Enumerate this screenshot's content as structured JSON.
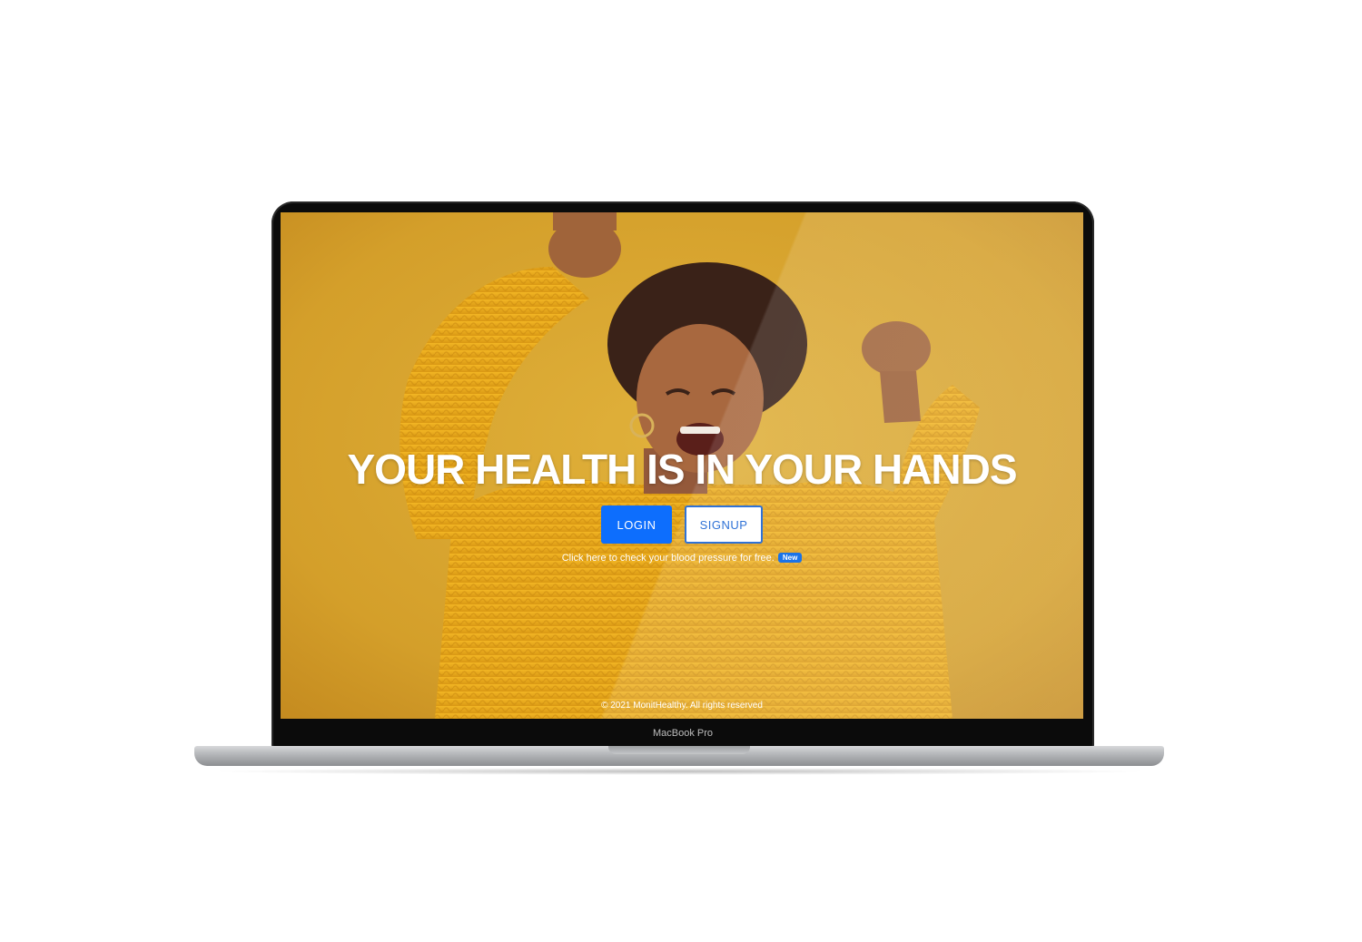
{
  "hero": {
    "title": "YOUR HEALTH IS IN YOUR HANDS",
    "login_label": "LOGIN",
    "signup_label": "SIGNUP",
    "bp_link_text": "Click here to check your blood pressure for free.",
    "new_badge": "New"
  },
  "footer": {
    "copyright": "© 2021 MonitHealthy. All rights reserved"
  },
  "device": {
    "model_label": "MacBook Pro"
  },
  "colors": {
    "background": "#d9a52e",
    "primary": "#0d6efd",
    "signup_border": "#2f72d6"
  },
  "icons": {
    "new_badge": "new-badge"
  }
}
